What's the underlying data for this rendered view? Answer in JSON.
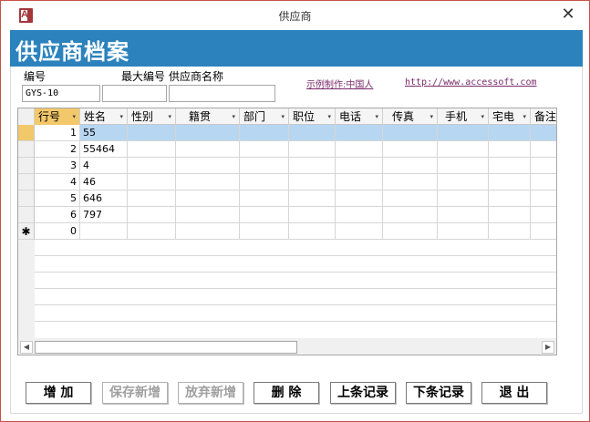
{
  "window": {
    "title": "供应商",
    "close_glyph": "✕",
    "app_icon_letter": "A"
  },
  "form": {
    "header_title": "供应商档案",
    "labels": {
      "code": "编号",
      "max_code": "最大编号",
      "supplier_name": "供应商名称"
    },
    "fields": {
      "code_value": "GYS-10",
      "max_code_value": "",
      "supplier_name_value": ""
    },
    "credit_text": "示例制作:中国人",
    "credit_url": "http://www.accessoft.com"
  },
  "grid": {
    "columns": [
      "行号",
      "姓名",
      "性别",
      "籍贯",
      "部门",
      "职位",
      "电话",
      "传真",
      "手机",
      "宅电",
      "备注"
    ],
    "rows": [
      {
        "selector": "",
        "line_no": "1",
        "name": "55"
      },
      {
        "selector": "",
        "line_no": "2",
        "name": "55464"
      },
      {
        "selector": "",
        "line_no": "3",
        "name": "4"
      },
      {
        "selector": "",
        "line_no": "4",
        "name": "46"
      },
      {
        "selector": "",
        "line_no": "5",
        "name": "646"
      },
      {
        "selector": "",
        "line_no": "6",
        "name": "797"
      },
      {
        "selector": "✱",
        "line_no": "0",
        "name": ""
      }
    ]
  },
  "buttons": {
    "add": "增  加",
    "save_new": "保存新增",
    "discard_new": "放弃新增",
    "delete": "删  除",
    "prev_record": "上条记录",
    "next_record": "下条记录",
    "exit": "退  出"
  },
  "icons": {
    "dropdown": "▾",
    "scroll_left": "◀",
    "scroll_right": "▶",
    "new_record": "✱"
  },
  "colors": {
    "header_bar": "#2b82bc",
    "selected_row": "#b7d6f1",
    "sorted_header": "#f3c86b",
    "window_border": "#c9524a"
  }
}
